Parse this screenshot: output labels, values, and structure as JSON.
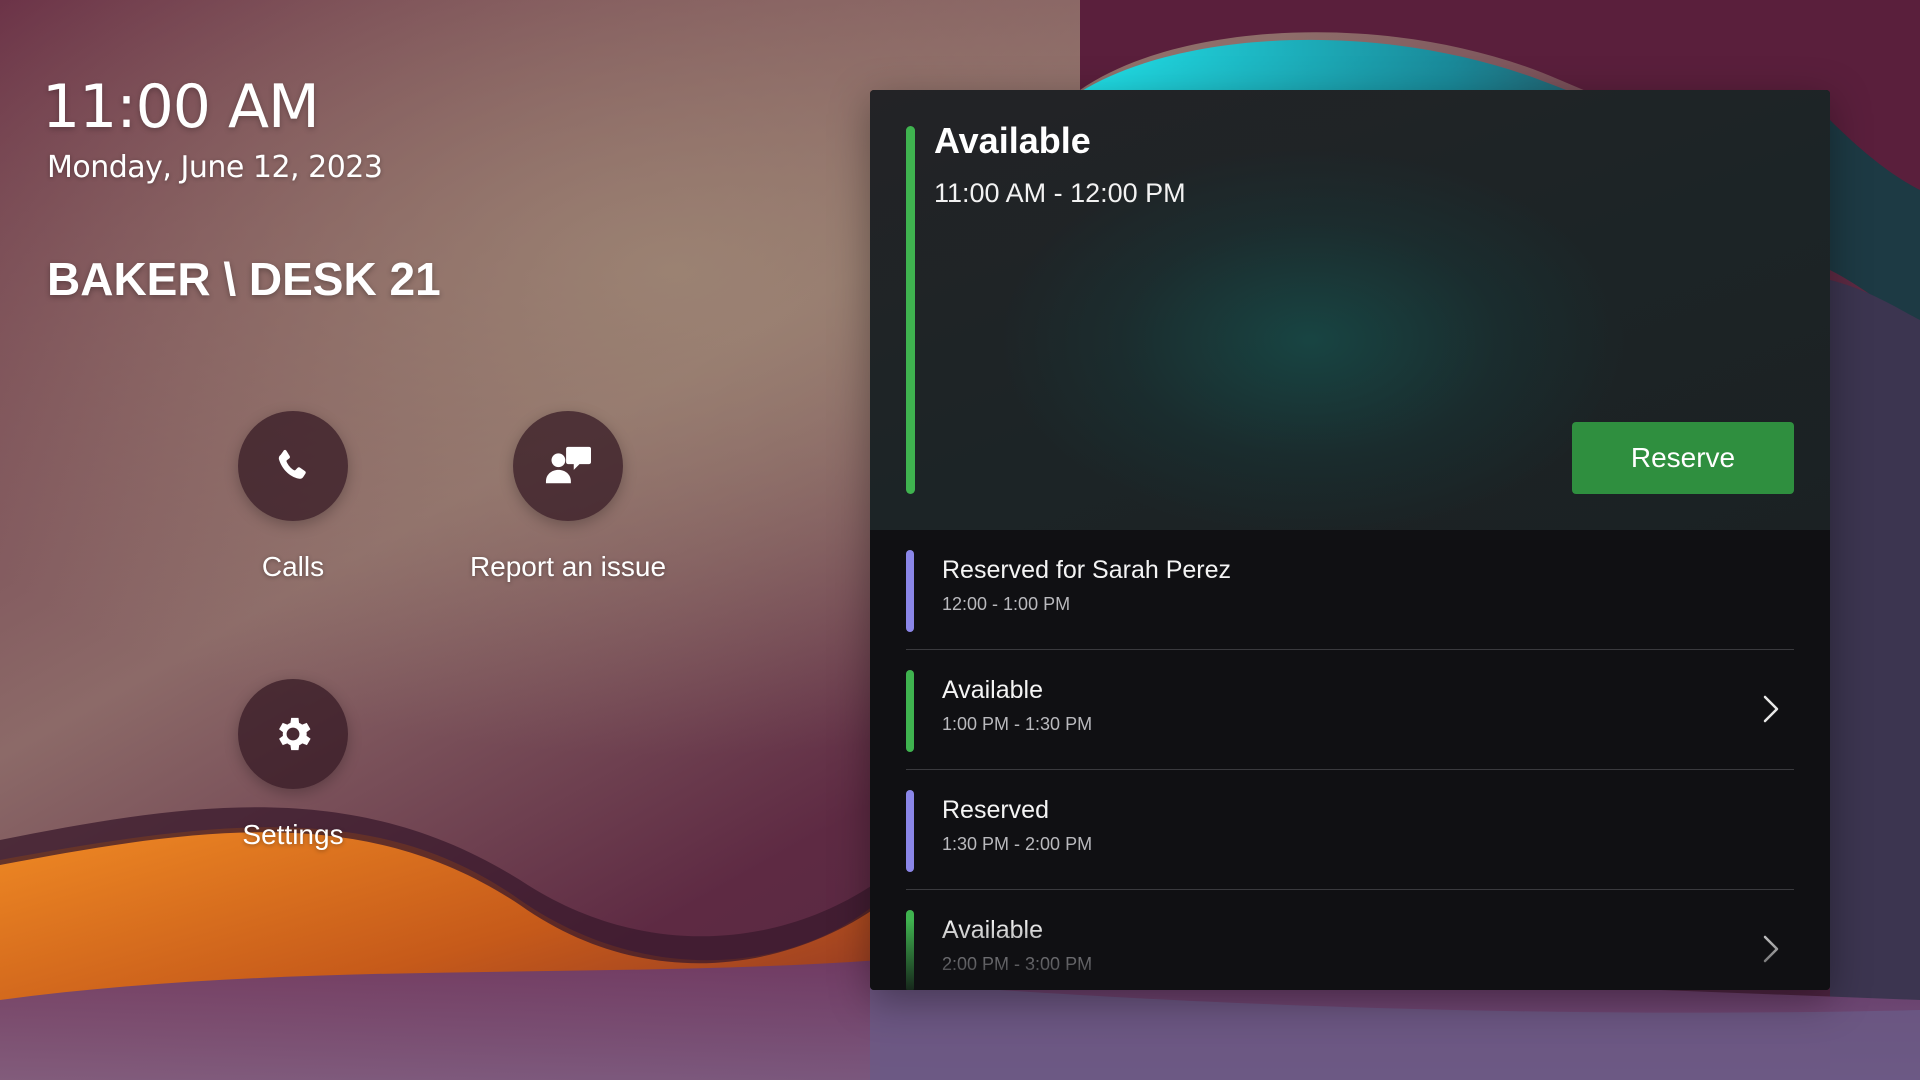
{
  "clock": {
    "time": "11:00 AM",
    "date": "Monday, June 12, 2023"
  },
  "room": {
    "name": "BAKER \\ DESK 21"
  },
  "actions": {
    "calls_label": "Calls",
    "report_label": "Report an issue",
    "settings_label": "Settings"
  },
  "icons": {
    "calls": "phone-icon",
    "report": "report-issue-icon",
    "settings": "gear-icon",
    "chevron": "chevron-right-icon"
  },
  "colors": {
    "available": "#3fb34f",
    "reserved": "#8b86e8",
    "reserve_button": "#2f8f3f"
  },
  "current": {
    "status": "Available",
    "time_range": "11:00 AM - 12:00 PM",
    "reserve_label": "Reserve"
  },
  "schedule": [
    {
      "title": "Reserved for Sarah Perez",
      "time": "12:00 - 1:00 PM",
      "status": "reserved"
    },
    {
      "title": "Available",
      "time": "1:00 PM - 1:30 PM",
      "status": "available"
    },
    {
      "title": "Reserved",
      "time": "1:30 PM - 2:00 PM",
      "status": "reserved"
    },
    {
      "title": "Available",
      "time": "2:00 PM - 3:00 PM",
      "status": "available"
    }
  ]
}
